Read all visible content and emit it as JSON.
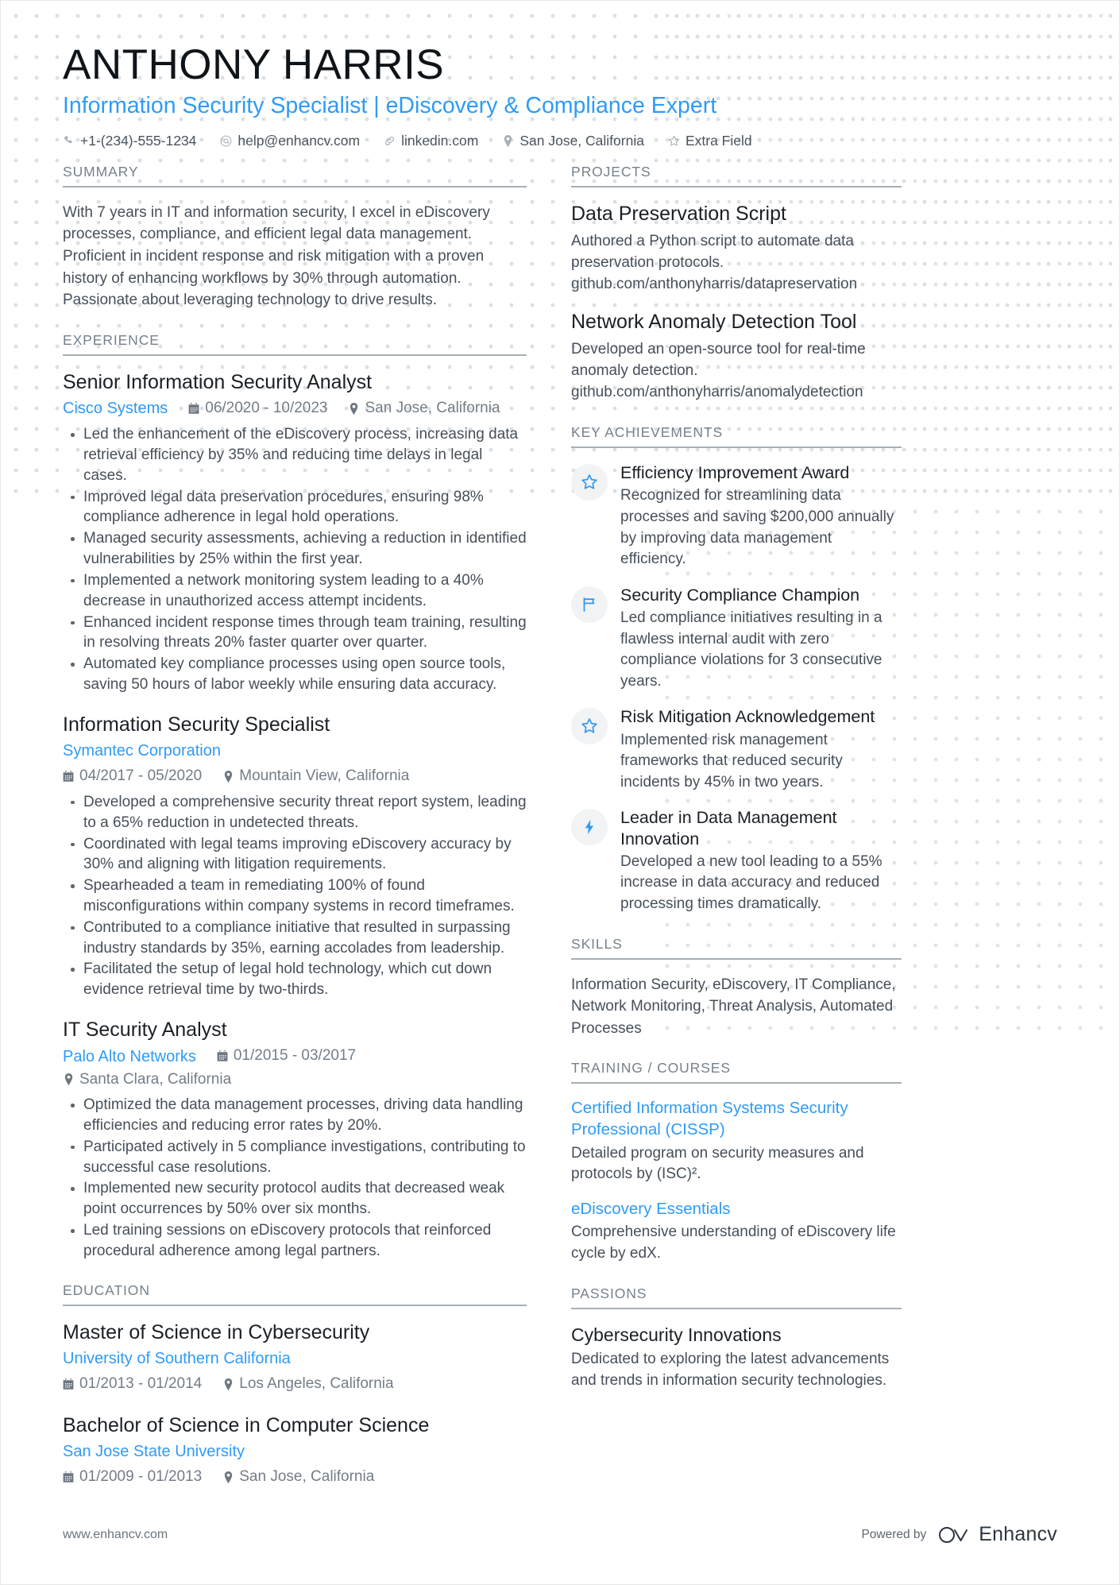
{
  "header": {
    "name": "ANTHONY HARRIS",
    "headline": "Information Security Specialist | eDiscovery & Compliance Expert",
    "contacts": [
      {
        "icon": "phone-icon",
        "text": "+1-(234)-555-1234"
      },
      {
        "icon": "email-icon",
        "text": "help@enhancv.com"
      },
      {
        "icon": "link-icon",
        "text": "linkedin.com"
      },
      {
        "icon": "location-pin-icon",
        "text": "San Jose, California"
      },
      {
        "icon": "star-icon",
        "text": "Extra Field"
      }
    ]
  },
  "sections": {
    "summary_title": "SUMMARY",
    "experience_title": "EXPERIENCE",
    "education_title": "EDUCATION",
    "projects_title": "PROJECTS",
    "achievements_title": "KEY ACHIEVEMENTS",
    "skills_title": "SKILLS",
    "training_title": "TRAINING / COURSES",
    "passions_title": "PASSIONS"
  },
  "summary": {
    "text": "With 7 years in IT and information security, I excel in eDiscovery processes, compliance, and efficient legal data management. Proficient in incident response and risk mitigation with a proven history of enhancing workflows by 30% through automation. Passionate about leveraging technology to drive results."
  },
  "experience": [
    {
      "title": "Senior Information Security Analyst",
      "org": "Cisco Systems",
      "dates": "06/2020 - 10/2023",
      "location": "San Jose, California",
      "stacked": false,
      "bullets": [
        "Led the enhancement of the eDiscovery process, increasing data retrieval efficiency by 35% and reducing time delays in legal cases.",
        "Improved legal data preservation procedures, ensuring 98% compliance adherence in legal hold operations.",
        "Managed security assessments, achieving a reduction in identified vulnerabilities by 25% within the first year.",
        "Implemented a network monitoring system leading to a 40% decrease in unauthorized access attempt incidents.",
        "Enhanced incident response times through team training, resulting in resolving threats 20% faster quarter over quarter.",
        "Automated key compliance processes using open source tools, saving 50 hours of labor weekly while ensuring data accuracy."
      ]
    },
    {
      "title": "Information Security Specialist",
      "org": "Symantec Corporation",
      "dates": "04/2017 - 05/2020",
      "location": "Mountain View, California",
      "stacked": true,
      "bullets": [
        "Developed a comprehensive security threat report system, leading to a 65% reduction in undetected threats.",
        "Coordinated with legal teams improving eDiscovery accuracy by 30% and aligning with litigation requirements.",
        "Spearheaded a team in remediating 100% of found misconfigurations within company systems in record timeframes.",
        "Contributed to a compliance initiative that resulted in surpassing industry standards by 35%, earning accolades from leadership.",
        "Facilitated the setup of legal hold technology, which cut down evidence retrieval time by two-thirds."
      ]
    },
    {
      "title": "IT Security Analyst",
      "org": "Palo Alto Networks",
      "dates": "01/2015 - 03/2017",
      "location": "Santa Clara, California",
      "stacked": false,
      "bullets": [
        "Optimized the data management processes, driving data handling efficiencies and reducing error rates by 20%.",
        "Participated actively in 5 compliance investigations, contributing to successful case resolutions.",
        "Implemented new security protocol audits that decreased weak point occurrences by 50% over six months.",
        "Led training sessions on eDiscovery protocols that reinforced procedural adherence among legal partners."
      ]
    }
  ],
  "education": [
    {
      "degree": "Master of Science in Cybersecurity",
      "school": "University of Southern California",
      "dates": "01/2013 - 01/2014",
      "location": "Los Angeles, California"
    },
    {
      "degree": "Bachelor of Science in Computer Science",
      "school": "San Jose State University",
      "dates": "01/2009 - 01/2013",
      "location": "San Jose, California"
    }
  ],
  "projects": [
    {
      "title": "Data Preservation Script",
      "description": "Authored a Python script to automate data preservation protocols. github.com/anthonyharris/datapreservation"
    },
    {
      "title": "Network Anomaly Detection Tool",
      "description": "Developed an open-source tool for real-time anomaly detection. github.com/anthonyharris/anomalydetection"
    }
  ],
  "achievements": [
    {
      "icon": "star-outline-icon",
      "title": "Efficiency Improvement Award",
      "description": "Recognized for streamlining data processes and saving $200,000 annually by improving data management efficiency."
    },
    {
      "icon": "flag-icon",
      "title": "Security Compliance Champion",
      "description": "Led compliance initiatives resulting in a flawless internal audit with zero compliance violations for 3 consecutive years."
    },
    {
      "icon": "star-outline-icon",
      "title": "Risk Mitigation Acknowledgement",
      "description": "Implemented risk management frameworks that reduced security incidents by 45% in two years."
    },
    {
      "icon": "lightning-bolt-icon",
      "title": "Leader in Data Management Innovation",
      "description": "Developed a new tool leading to a 55% increase in data accuracy and reduced processing times dramatically."
    }
  ],
  "skills": {
    "text": "Information Security, eDiscovery, IT Compliance, Network Monitoring, Threat Analysis, Automated Processes"
  },
  "training": [
    {
      "title": "Certified Information Systems Security Professional (CISSP)",
      "description": "Detailed program on security measures and protocols by (ISC)²."
    },
    {
      "title": "eDiscovery Essentials",
      "description": "Comprehensive understanding of eDiscovery life cycle by edX."
    }
  ],
  "passions": [
    {
      "title": "Cybersecurity Innovations",
      "description": "Dedicated to exploring the latest advancements and trends in information security technologies."
    }
  ],
  "footer": {
    "url": "www.enhancv.com",
    "powered_label": "Powered by",
    "brand": "Enhancv"
  },
  "colors": {
    "accent": "#2f9bf5",
    "heading": "#1b2026",
    "body": "#464f59",
    "muted": "#76818c",
    "rule": "#a8aeb4",
    "icon_bg": "#f2f3f4"
  }
}
